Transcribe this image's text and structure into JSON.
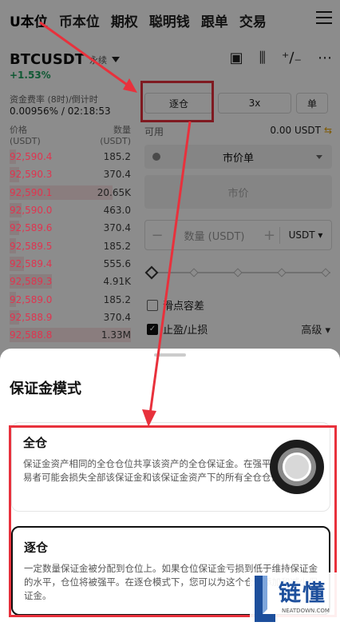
{
  "top_tabs": [
    "U本位",
    "币本位",
    "期权",
    "聪明钱",
    "跟单",
    "交易"
  ],
  "pair": {
    "name": "BTCUSDT",
    "type": "永续",
    "change": "+1.53%"
  },
  "funding": {
    "label": "资金费率 (8时)/倒计时",
    "value": "0.00956% / 02:18:53"
  },
  "orderbook": {
    "price_label": "价格",
    "price_unit": "(USDT)",
    "qty_label": "数量",
    "qty_unit": "(USDT)",
    "rows": [
      {
        "price": "92,590.4",
        "qty": "185.2",
        "depth": 0.05
      },
      {
        "price": "92,590.3",
        "qty": "370.4",
        "depth": 0.08
      },
      {
        "price": "92,590.1",
        "qty": "20.65K",
        "depth": 0.85
      },
      {
        "price": "92,590.0",
        "qty": "463.0",
        "depth": 0.1
      },
      {
        "price": "92,589.6",
        "qty": "370.4",
        "depth": 0.08
      },
      {
        "price": "92,589.5",
        "qty": "185.2",
        "depth": 0.05
      },
      {
        "price": "92,589.4",
        "qty": "555.6",
        "depth": 0.12
      },
      {
        "price": "92,589.3",
        "qty": "4.91K",
        "depth": 0.35
      },
      {
        "price": "92,589.0",
        "qty": "185.2",
        "depth": 0.05
      },
      {
        "price": "92,588.9",
        "qty": "370.4",
        "depth": 0.08
      },
      {
        "price": "92,588.8",
        "qty": "1.33M",
        "depth": 1.0
      }
    ]
  },
  "order_panel": {
    "margin_mode": "逐仓",
    "leverage": "3x",
    "single": "单",
    "available_label": "可用",
    "available_value": "0.00 USDT",
    "order_type": "市价单",
    "market_price": "市价",
    "qty_placeholder": "数量 (USDT)",
    "qty_unit": "USDT",
    "slippage_label": "滑点容差",
    "tpsl_label": "止盈/止损",
    "advanced_label": "高级"
  },
  "sheet": {
    "title": "保证金模式",
    "options": [
      {
        "title": "全仓",
        "desc": "保证金资产相同的全仓仓位共享该资产的全仓保证金。在强平事件中，交易者可能会损失全部该保证金和该保证金资产下的所有全仓仓位。"
      },
      {
        "title": "逐仓",
        "desc": "一定数量保证金被分配到仓位上。如果仓位保证金亏损到低于维持保证金的水平，仓位将被强平。在逐仓模式下，您可以为这个仓位添加和减少保证金。"
      }
    ]
  },
  "watermark": {
    "text": "链懂",
    "sub": "NEATDOWN.COM"
  },
  "colors": {
    "ask": "#e0344f",
    "up": "#1fa35f",
    "annotation": "#e8313c"
  }
}
